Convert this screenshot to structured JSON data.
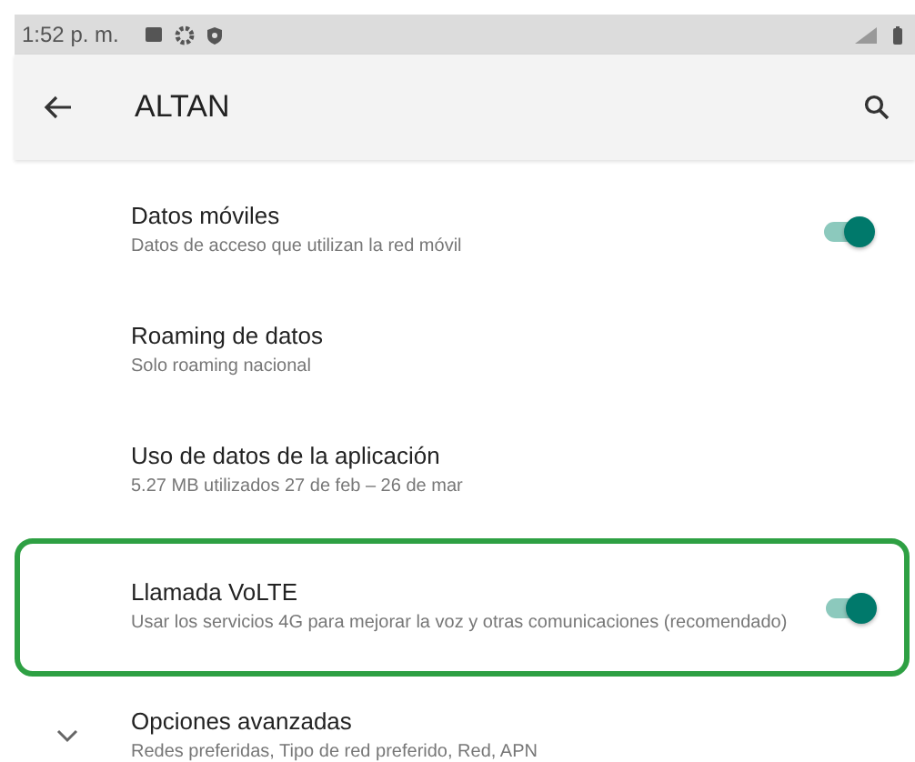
{
  "status_bar": {
    "time": "1:52 p. m."
  },
  "app_bar": {
    "title": "ALTAN"
  },
  "settings": [
    {
      "kind": "toggle",
      "title": "Datos móviles",
      "summary": "Datos de acceso que utilizan la red móvil",
      "on": true,
      "highlighted": false
    },
    {
      "kind": "plain",
      "title": "Roaming de datos",
      "summary": "Solo roaming nacional",
      "highlighted": false
    },
    {
      "kind": "plain",
      "title": "Uso de datos de la aplicación",
      "summary": "5.27 MB utilizados 27 de feb – 26 de mar",
      "highlighted": false
    },
    {
      "kind": "toggle",
      "title": "Llamada VoLTE",
      "summary": "Usar los servicios 4G para mejorar la voz y otras comunicaciones (recomendado)",
      "on": true,
      "highlighted": true
    },
    {
      "kind": "expand",
      "title": "Opciones avanzadas",
      "summary": "Redes preferidas, Tipo de red preferido, Red, APN",
      "expanded": false,
      "highlighted": false
    }
  ]
}
